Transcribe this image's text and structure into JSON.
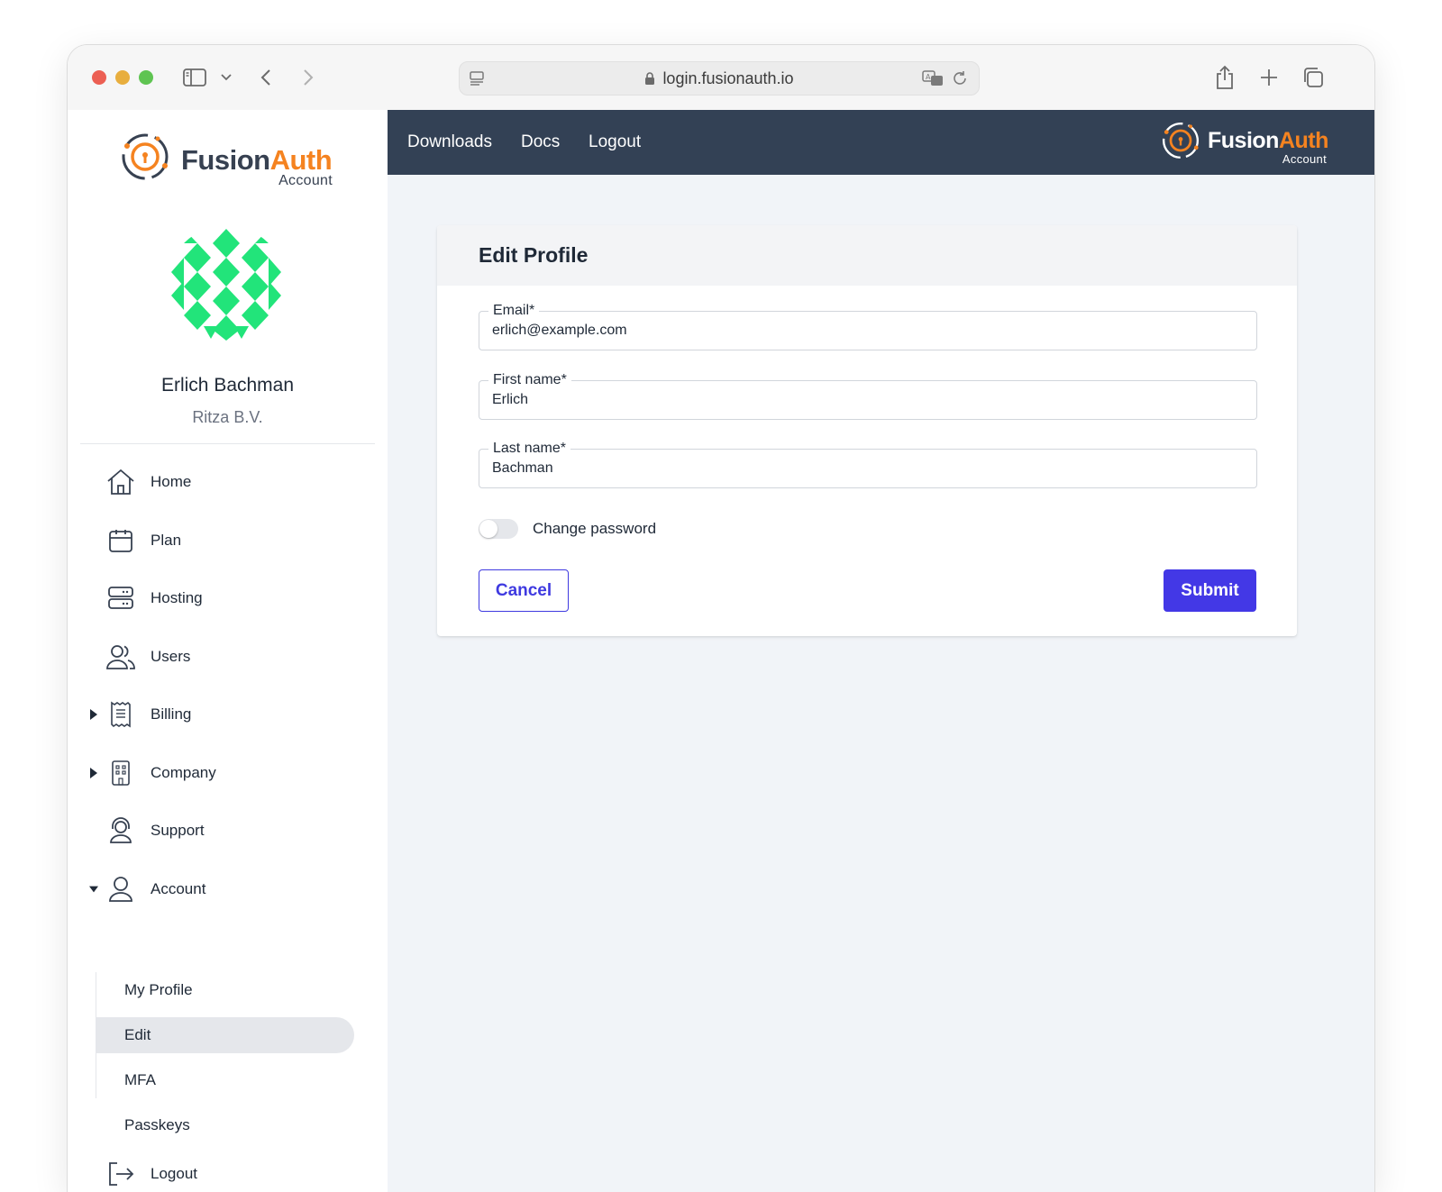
{
  "browser": {
    "url": "login.fusionauth.io"
  },
  "brand": {
    "name_part1": "Fusion",
    "name_part2": "Auth",
    "sub": "Account",
    "accent_color": "#f58320"
  },
  "profile": {
    "name": "Erlich Bachman",
    "org": "Ritza B.V."
  },
  "sidebar": {
    "items": [
      {
        "label": "Home",
        "icon": "home-icon"
      },
      {
        "label": "Plan",
        "icon": "calendar-icon"
      },
      {
        "label": "Hosting",
        "icon": "server-icon"
      },
      {
        "label": "Users",
        "icon": "users-icon"
      },
      {
        "label": "Billing",
        "icon": "receipt-icon"
      },
      {
        "label": "Company",
        "icon": "building-icon"
      },
      {
        "label": "Support",
        "icon": "headset-icon"
      },
      {
        "label": "Account",
        "icon": "user-icon"
      }
    ],
    "account_sub": [
      {
        "label": "My Profile"
      },
      {
        "label": "Edit"
      },
      {
        "label": "MFA"
      },
      {
        "label": "Passkeys"
      }
    ],
    "logout": {
      "label": "Logout",
      "icon": "logout-icon"
    }
  },
  "topnav": {
    "links": [
      "Downloads",
      "Docs",
      "Logout"
    ],
    "background": "#334155"
  },
  "form": {
    "title": "Edit Profile",
    "email": {
      "label": "Email*",
      "value": "erlich@example.com"
    },
    "first_name": {
      "label": "First name*",
      "value": "Erlich"
    },
    "last_name": {
      "label": "Last name*",
      "value": "Bachman"
    },
    "change_password": {
      "label": "Change password",
      "on": false
    },
    "cancel_label": "Cancel",
    "submit_label": "Submit",
    "primary_color": "#4338e6"
  }
}
